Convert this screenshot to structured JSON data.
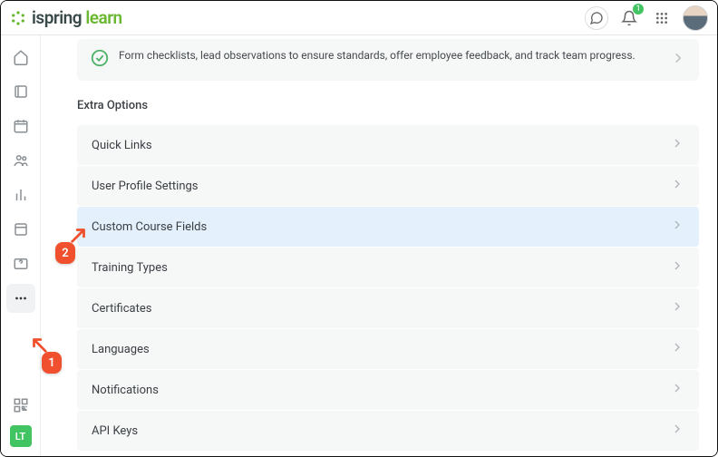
{
  "header": {
    "logo_brand": "ispring",
    "logo_product": "learn",
    "notif_count": "1"
  },
  "sidebar": {
    "user_initials": "LT"
  },
  "main": {
    "info_text": "Form checklists, lead observations to ensure standards, offer employee feedback, and track team progress.",
    "section_title": "Extra Options",
    "options": {
      "quick_links": "Quick Links",
      "user_profile_settings": "User Profile Settings",
      "custom_course_fields": "Custom Course Fields",
      "training_types": "Training Types",
      "certificates": "Certificates",
      "languages": "Languages",
      "notifications": "Notifications",
      "api_keys": "API Keys"
    }
  },
  "callouts": {
    "step1": "1",
    "step2": "2"
  }
}
